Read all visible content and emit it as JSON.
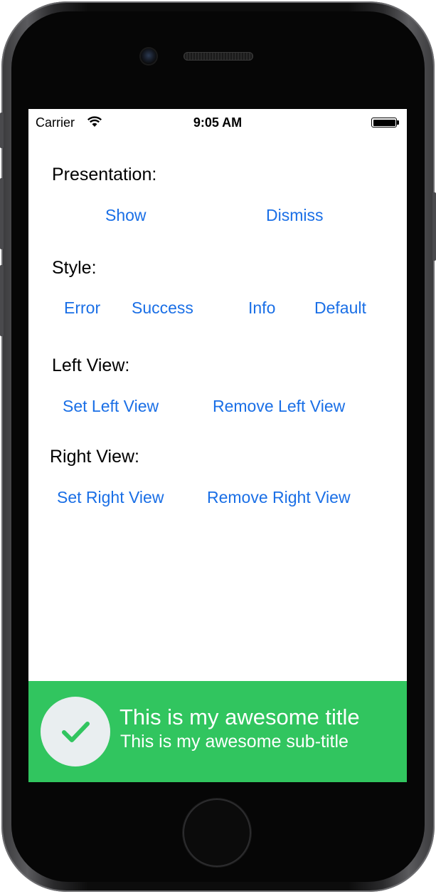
{
  "status_bar": {
    "carrier": "Carrier",
    "time": "9:05 AM"
  },
  "presentation": {
    "label": "Presentation:",
    "show": "Show",
    "dismiss": "Dismiss"
  },
  "style": {
    "label": "Style:",
    "error": "Error",
    "success": "Success",
    "info": "Info",
    "default": "Default"
  },
  "left_view": {
    "label": "Left View:",
    "set": "Set Left View",
    "remove": "Remove Left View"
  },
  "right_view": {
    "label": "Right View:",
    "set": "Set Right View",
    "remove": "Remove Right View"
  },
  "banner": {
    "title": "This is my awesome title",
    "subtitle": "This is my awesome sub-title",
    "icon": "checkmark-icon",
    "color": "#31c55f",
    "icon_color": "#31c55f"
  },
  "colors": {
    "link": "#1a6fe6",
    "screen_background": "#ffffff"
  }
}
